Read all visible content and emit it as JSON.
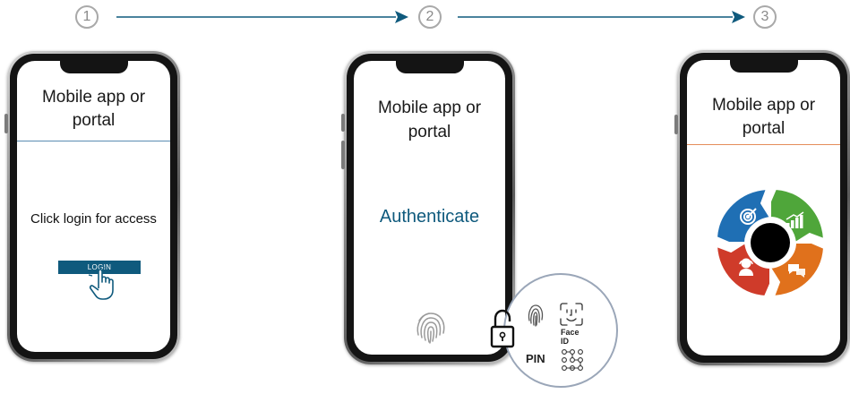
{
  "colors": {
    "accent_blue": "#0f5a7d",
    "divider_blue": "#5b8db2",
    "divider_orange": "#e58d5a",
    "seg_blue": "#1f6fb4",
    "seg_green": "#4fa63a",
    "seg_orange": "#e0711c",
    "seg_red": "#cf3b2a"
  },
  "steps": [
    {
      "number": "1"
    },
    {
      "number": "2"
    },
    {
      "number": "3"
    }
  ],
  "phones": [
    {
      "title_line1": "Mobile app or",
      "title_line2": "portal",
      "body_text": "Click login for access",
      "button_label": "LOGIN"
    },
    {
      "title_line1": "Mobile app or",
      "title_line2": "portal",
      "body_text": "Authenticate"
    },
    {
      "title_line1": "Mobile app or",
      "title_line2": "portal"
    }
  ],
  "auth_options": {
    "face_id_label": "Face ID",
    "pin_label": "PIN"
  },
  "icons": {
    "click": "hand-pointer-icon",
    "fingerprint": "fingerprint-icon",
    "lock": "padlock-icon",
    "face_id": "face-id-icon",
    "pattern": "pattern-lock-icon",
    "cycle": [
      "target-icon",
      "growth-chart-icon",
      "chat-icon",
      "support-agent-icon"
    ]
  }
}
